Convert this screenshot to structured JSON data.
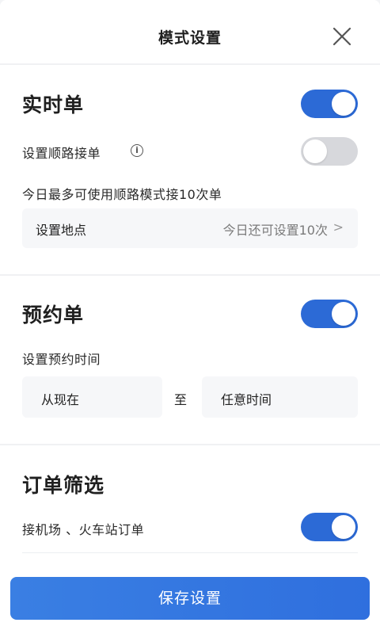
{
  "header": {
    "title": "模式设置",
    "close_icon": "close-icon"
  },
  "realtime": {
    "title": "实时单",
    "toggle_on": true,
    "route_label": "设置顺路接单",
    "route_toggle_on": false,
    "limit_note": "今日最多可使用顺路模式接10次单",
    "location_row": {
      "label": "设置地点",
      "value": "今日还可设置10次",
      "chevron": ">"
    }
  },
  "reservation": {
    "title": "预约单",
    "toggle_on": true,
    "time_label": "设置预约时间",
    "from": "从现在",
    "to_word": "至",
    "until": "任意时间"
  },
  "filter": {
    "title": "订单筛选",
    "airport_label": "接机场 、火车站订单",
    "airport_toggle_on": true
  },
  "footer": {
    "save_label": "保存设置"
  },
  "colors": {
    "accent": "#2c6ad6",
    "toggle_off": "#d7d8dc",
    "button": "#3176e0"
  }
}
